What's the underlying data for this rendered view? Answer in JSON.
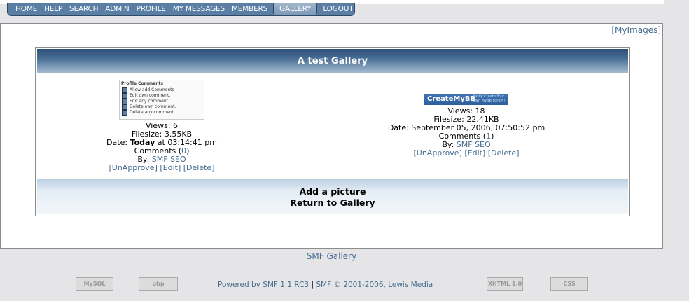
{
  "nav": {
    "tabs": [
      "HOME",
      "HELP",
      "SEARCH",
      "ADMIN",
      "PROFILE",
      "MY MESSAGES",
      "MEMBERS",
      "GALLERY",
      "LOGOUT"
    ],
    "active": "GALLERY"
  },
  "panel": {
    "myimages": "[MyImages]"
  },
  "gallery": {
    "title": "A test Gallery",
    "items": [
      {
        "thumb_title": "Profile Comments",
        "thumb_rows": [
          "Allow add Comments",
          "Edit own comment.",
          "Edit any comment",
          "Delete own comment.",
          "Delete any comment"
        ],
        "views": "Views: 6",
        "filesize": "Filesize: 3.55KB",
        "date_prefix": "Date: ",
        "date_bold": "Today",
        "date_suffix": " at 03:14:41 pm",
        "comments_prefix": "Comments (",
        "comments_count": "0",
        "comments_suffix": ")",
        "by_prefix": "By: ",
        "author": "SMF SEO",
        "unapprove": "[UnApprove]",
        "edit": "[Edit]",
        "delete": "[Delete]"
      },
      {
        "thumb_title": "CreateMyBB",
        "thumb_tagline": "Easily Create Your Own MyBB Forum!",
        "views": "Views: 18",
        "filesize": "Filesize: 22.41KB",
        "date": "Date: September 05, 2006, 07:50:52 pm",
        "comments_prefix": "Comments (",
        "comments_count": "1",
        "comments_suffix": ")",
        "by_prefix": "By: ",
        "author": "SMF SEO",
        "unapprove": "[UnApprove]",
        "edit": "[Edit]",
        "delete": "[Delete]"
      }
    ],
    "add_picture": "Add a picture",
    "return": "Return to Gallery"
  },
  "smf_gallery": "SMF Gallery",
  "footer": {
    "powered": "Powered by SMF 1.1 RC3",
    "sep": " | ",
    "copyright": "SMF © 2001-2006, Lewis Media",
    "badges": [
      "MySQL",
      "php",
      "XHTML 1.0",
      "CSS"
    ]
  },
  "colors": {
    "link": "#476c8e",
    "nav": "#5a7ea4",
    "header_dark": "#2c4f76"
  }
}
